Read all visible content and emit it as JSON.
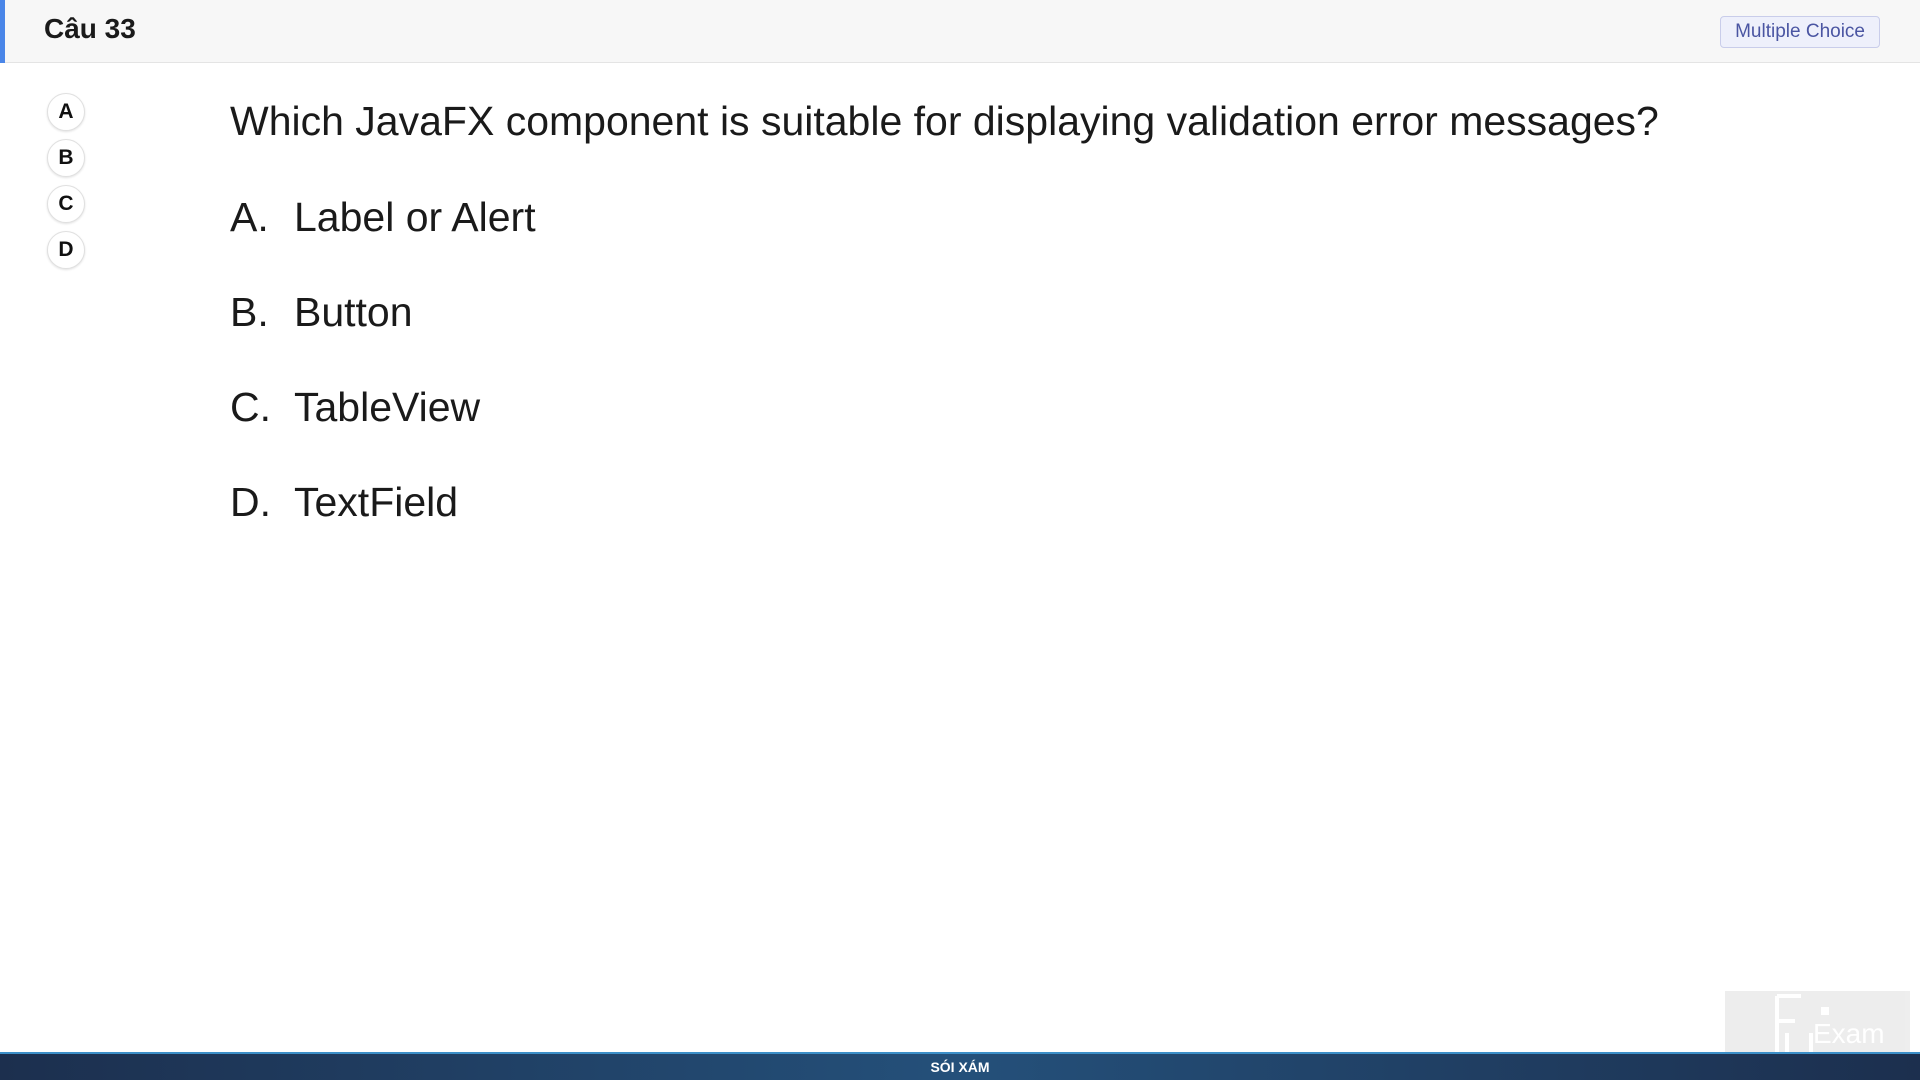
{
  "header": {
    "title": "Câu 33",
    "type_badge": "Multiple Choice",
    "accent_color": "#4a86e8"
  },
  "answer_nav": {
    "options": [
      "A",
      "B",
      "C",
      "D"
    ]
  },
  "question": {
    "text": "Which JavaFX component is suitable for displaying validation error messages?",
    "options": [
      {
        "letter": "A.",
        "text": "Label or Alert"
      },
      {
        "letter": "B.",
        "text": "Button"
      },
      {
        "letter": "C.",
        "text": "TableView"
      },
      {
        "letter": "D.",
        "text": "TextField"
      }
    ]
  },
  "footer": {
    "text": "SÓI XÁM"
  },
  "watermark": {
    "text": "Exam",
    "icon": "fu-exam-logo"
  }
}
